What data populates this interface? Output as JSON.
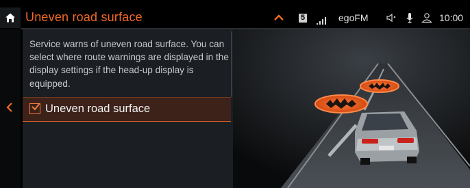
{
  "header": {
    "title": "Uneven road surface",
    "channel_badge": "5",
    "station": "egoFM",
    "time": "10:00"
  },
  "panel": {
    "description": "Service warns of uneven road surface. You can select where route warnings are displayed in the display settings if the head-up display is equipped.",
    "option_label": "Uneven road surface",
    "option_checked": true
  },
  "colors": {
    "accent": "#f26a25",
    "panel_bg": "#1b1e22",
    "selected_row_bg": "#3d221a"
  },
  "icons": [
    "home-icon",
    "chevron-up-icon",
    "signal-icon",
    "mute-speaker-icon",
    "microphone-icon",
    "user-icon",
    "chevron-left-icon",
    "checkbox-checked-icon"
  ]
}
